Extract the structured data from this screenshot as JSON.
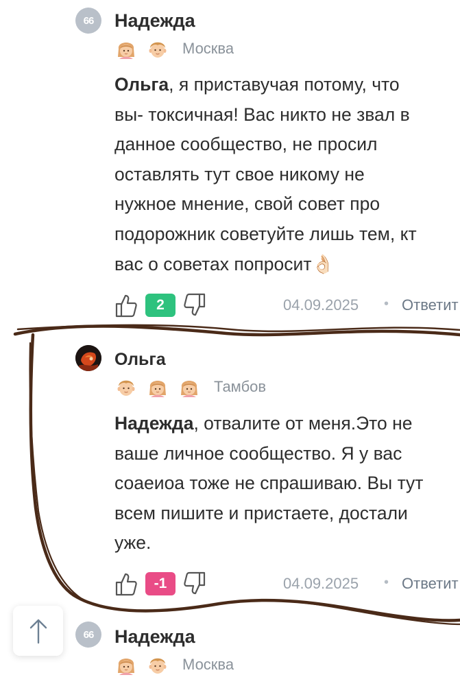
{
  "comments": [
    {
      "avatar_text": "66",
      "author": "Надежда",
      "badges": [
        "girl-badge-icon",
        "boy-badge-icon"
      ],
      "city": "Москва",
      "mention": "Ольга",
      "lines": [
        ", я приставучая потому, что",
        "вы- токсичная! Вас никто не звал в",
        "данное сообщество, не просил",
        "оставлять тут свое никому не",
        "нужное мнение, свой совет про",
        "подорожник советуйте лишь тем, кт",
        "вас о советах попросит"
      ],
      "emoji": "👌🏻",
      "score": "2",
      "score_color": "#2ec27e",
      "date": "04.09.2025",
      "reply": "Ответит"
    },
    {
      "avatar": "user-photo",
      "author": "Ольга",
      "badges": [
        "boy-badge-icon",
        "girl-badge-icon",
        "girl-badge-icon"
      ],
      "city": "Тамбов",
      "mention": "Надежда",
      "lines": [
        ", отвалите от меня.Это не",
        "ваше личное сообщество. Я у вас",
        "соаеиоа тоже не спрашиваю. Вы тут",
        "всем пишите и пристаете, достали",
        "уже."
      ],
      "score": "-1",
      "score_color": "#e94c86",
      "date": "04.09.2025",
      "reply": "Ответит"
    },
    {
      "avatar_text": "66",
      "author": "Надежда",
      "badges": [
        "girl-badge-icon",
        "boy-badge-icon"
      ],
      "city": "Москва"
    }
  ],
  "scroll_top": {
    "icon": "arrow-up-icon"
  },
  "colors": {
    "marker": "#4a2a18",
    "meta_gray": "#8a929a",
    "reply_link": "#6b7886"
  }
}
